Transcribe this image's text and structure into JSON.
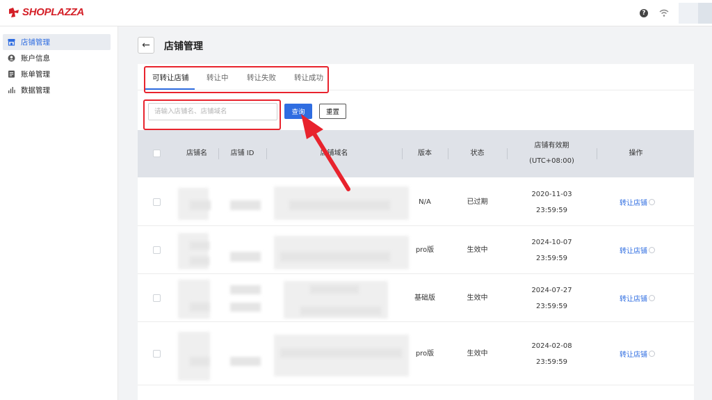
{
  "brand": {
    "name": "SHOPLAZZA",
    "color": "#d41f27",
    "mark_icon": "shoplazza-logo-icon"
  },
  "header": {
    "icons": [
      "help-icon",
      "wifi-icon",
      "avatar"
    ]
  },
  "sidebar": {
    "items": [
      {
        "label": "店铺管理",
        "icon": "store-icon",
        "active": true
      },
      {
        "label": "账户信息",
        "icon": "user-circle-icon"
      },
      {
        "label": "账单管理",
        "icon": "bill-icon"
      },
      {
        "label": "数据管理",
        "icon": "bar-chart-icon"
      }
    ]
  },
  "page": {
    "title": "店铺管理",
    "back_icon": "arrow-left-icon"
  },
  "tabs": [
    "可转让店铺",
    "转让中",
    "转让失败",
    "转让成功"
  ],
  "active_tab": 0,
  "search": {
    "placeholder": "请输入店铺名、店铺域名",
    "value": "",
    "query_label": "查询",
    "reset_label": "重置"
  },
  "table": {
    "columns": [
      "店铺名",
      "店铺 ID",
      "店铺域名",
      "版本",
      "状态",
      "店铺有效期",
      "操作"
    ],
    "expiry_header_line2": "(UTC+08:00)",
    "rows": [
      {
        "version": "N/A",
        "status": "已过期",
        "expiry_date": "2020-11-03",
        "expiry_time": "23:59:59",
        "action": "转让店铺"
      },
      {
        "version": "pro版",
        "status": "生效中",
        "expiry_date": "2024-10-07",
        "expiry_time": "23:59:59",
        "action": "转让店铺"
      },
      {
        "version": "基础版",
        "status": "生效中",
        "expiry_date": "2024-07-27",
        "expiry_time": "23:59:59",
        "action": "转让店铺"
      },
      {
        "version": "pro版",
        "status": "生效中",
        "expiry_date": "2024-02-08",
        "expiry_time": "23:59:59",
        "action": "转让店铺"
      }
    ]
  },
  "colors": {
    "primary": "#2f6de1",
    "annotation": "#e8232d",
    "header_bg": "#dfe2e8"
  }
}
